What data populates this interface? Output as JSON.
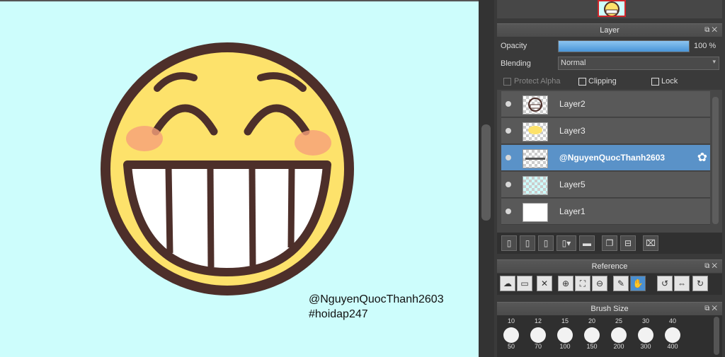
{
  "canvas": {
    "caption_line1": "@NguyenQuocThanh2603",
    "caption_line2": "#hoidap247"
  },
  "layer_panel": {
    "title": "Layer",
    "opacity_label": "Opacity",
    "opacity_value": "100 %",
    "opacity_fraction": 1.0,
    "blending_label": "Blending",
    "blending_value": "Normal",
    "protect_alpha_label": "Protect Alpha",
    "clipping_label": "Clipping",
    "lock_label": "Lock",
    "layers": [
      {
        "name": "Layer2",
        "selected": false
      },
      {
        "name": "Layer3",
        "selected": false
      },
      {
        "name": "@NguyenQuocThanh2603",
        "selected": true
      },
      {
        "name": "Layer5",
        "selected": false
      },
      {
        "name": "Layer1",
        "selected": false
      }
    ]
  },
  "reference_panel": {
    "title": "Reference"
  },
  "brush_panel": {
    "title": "Brush Size",
    "sizes_top": [
      "10",
      "12",
      "15",
      "20",
      "25",
      "30",
      "40"
    ],
    "sizes_bottom": [
      "50",
      "70",
      "100",
      "150",
      "200",
      "300",
      "400"
    ]
  },
  "colors": {
    "canvas_bg": "#cdfdfc",
    "selected_layer": "#5a92c8",
    "accent": "#4a8fd0",
    "face_yellow": "#fde26b",
    "face_outline": "#4d2f2a"
  }
}
